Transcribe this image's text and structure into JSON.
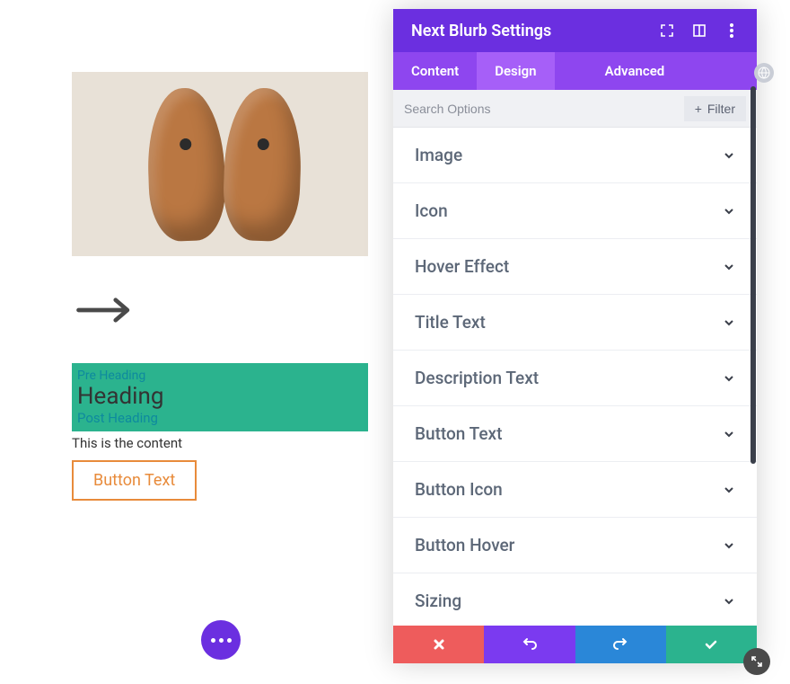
{
  "preview": {
    "pre_heading": "Pre Heading",
    "heading": "Heading",
    "post_heading": "Post Heading",
    "content": "This is the content",
    "button_label": "Button Text"
  },
  "panel": {
    "title": "Next Blurb Settings",
    "tabs": {
      "content": "Content",
      "design": "Design",
      "advanced": "Advanced"
    },
    "search_placeholder": "Search Options",
    "filter_label": "Filter",
    "sections": [
      "Image",
      "Icon",
      "Hover Effect",
      "Title Text",
      "Description Text",
      "Button Text",
      "Button Icon",
      "Button Hover",
      "Sizing"
    ],
    "colors": {
      "header": "#6b2fe0",
      "tabs": "#8e46ef",
      "tab_active": "#a65ff8",
      "cancel": "#ee5c5c",
      "undo": "#7b3af0",
      "redo": "#2a87d8",
      "save": "#2bb38e"
    }
  }
}
